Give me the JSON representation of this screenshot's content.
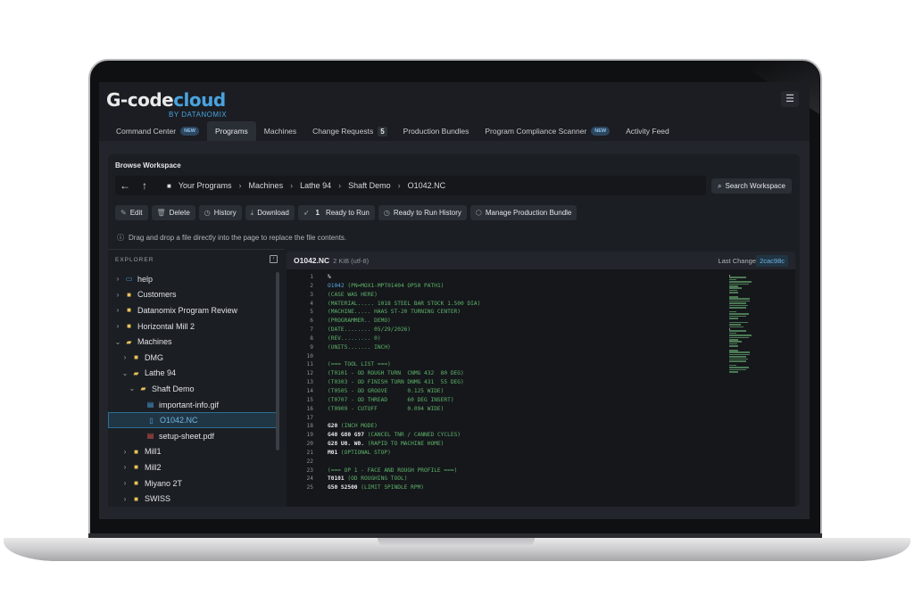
{
  "app": {
    "logo_main": "G-code",
    "logo_accent": "cloud",
    "logo_sub": "BY DATANOMIX",
    "menu_icon": "hamburger-icon"
  },
  "tabs": [
    {
      "label": "Command Center",
      "badge": "NEW"
    },
    {
      "label": "Programs",
      "active": true
    },
    {
      "label": "Machines"
    },
    {
      "label": "Change Requests",
      "count": "5"
    },
    {
      "label": "Production Bundles"
    },
    {
      "label": "Program Compliance Scanner",
      "badge": "NEW"
    },
    {
      "label": "Activity Feed"
    }
  ],
  "workspace": {
    "title": "Browse Workspace",
    "breadcrumb": [
      "Your Programs",
      "Machines",
      "Lathe 94",
      "Shaft Demo",
      "O1042.NC"
    ],
    "search_label": "Search Workspace",
    "hint": "Drag and drop a file directly into the page to replace the file contents."
  },
  "actions": {
    "edit": "Edit",
    "delete": "Delete",
    "history": "History",
    "download": "Download",
    "ready_count": "1",
    "ready": "Ready to Run",
    "ready_history": "Ready to Run History",
    "manage_bundle": "Manage Production Bundle"
  },
  "explorer": {
    "heading": "EXPLORER",
    "nodes": [
      {
        "label": "help",
        "type": "help",
        "depth": 0,
        "chev": "›"
      },
      {
        "label": "Customers",
        "type": "folder",
        "depth": 0,
        "chev": "›"
      },
      {
        "label": "Datanomix Program Review",
        "type": "folder",
        "depth": 0,
        "chev": "›"
      },
      {
        "label": "Horizontal Mill 2",
        "type": "folder",
        "depth": 0,
        "chev": "›"
      },
      {
        "label": "Machines",
        "type": "folder-open",
        "depth": 0,
        "chev": "⌄"
      },
      {
        "label": "DMG",
        "type": "folder",
        "depth": 1,
        "chev": "›"
      },
      {
        "label": "Lathe 94",
        "type": "folder-open",
        "depth": 1,
        "chev": "⌄"
      },
      {
        "label": "Shaft Demo",
        "type": "folder-open",
        "depth": 2,
        "chev": "⌄"
      },
      {
        "label": "important-info.gif",
        "type": "doc",
        "depth": 3,
        "chev": ""
      },
      {
        "label": "O1042.NC",
        "type": "file",
        "depth": 3,
        "chev": "",
        "selected": true
      },
      {
        "label": "setup-sheet.pdf",
        "type": "pdf",
        "depth": 3,
        "chev": ""
      },
      {
        "label": "Mill1",
        "type": "folder",
        "depth": 1,
        "chev": "›"
      },
      {
        "label": "Mill2",
        "type": "folder",
        "depth": 1,
        "chev": "›"
      },
      {
        "label": "Miyano 2T",
        "type": "folder",
        "depth": 1,
        "chev": "›"
      },
      {
        "label": "SWISS",
        "type": "folder",
        "depth": 1,
        "chev": "›"
      }
    ]
  },
  "editor": {
    "filename": "O1042.NC",
    "meta": "2 KiB (utf-8)",
    "last_change_label": "Last Change",
    "last_change_hash": "2cac98c",
    "lines": [
      {
        "n": "1",
        "t": "%",
        "k": "tx"
      },
      {
        "n": "2",
        "t": "O1042",
        "c": " (PN=MOX1-MPT01404 OP50 PATH1)",
        "k": "kw"
      },
      {
        "n": "3",
        "c": "(CASE WAS HERE)"
      },
      {
        "n": "4",
        "c": "(MATERIAL..... 1018 STEEL BAR STOCK 1.500 DIA)"
      },
      {
        "n": "5",
        "c": "(MACHINE..... HAAS ST-20 TURNING CENTER)"
      },
      {
        "n": "6",
        "c": "(PROGRAMMER.. DEMO)"
      },
      {
        "n": "7",
        "c": "(DATE........ 05/29/2026)"
      },
      {
        "n": "8",
        "c": "(REV......... 0)"
      },
      {
        "n": "9",
        "c": "(UNITS....... INCH)"
      },
      {
        "n": "10",
        "t": ""
      },
      {
        "n": "11",
        "c": "(=== TOOL LIST ===)"
      },
      {
        "n": "12",
        "c": "(T0101 - OD ROUGH TURN  CNMG 432  80 DEG)"
      },
      {
        "n": "13",
        "c": "(T0303 - OD FINISH TURN DNMG 431  55 DEG)"
      },
      {
        "n": "14",
        "c": "(T0505 - OD GROOVE      0.125 WIDE)"
      },
      {
        "n": "15",
        "c": "(T0707 - OD THREAD      60 DEG INSERT)"
      },
      {
        "n": "16",
        "c": "(T0909 - CUTOFF         0.094 WIDE)"
      },
      {
        "n": "17",
        "t": ""
      },
      {
        "n": "18",
        "t": "G20",
        "c": " (INCH MODE)"
      },
      {
        "n": "19",
        "t": "G40 G80 G97",
        "c": " (CANCEL TNR / CANNED CYCLES)"
      },
      {
        "n": "20",
        "t": "G28 U0. W0.",
        "c": " (RAPID TO MACHINE HOME)"
      },
      {
        "n": "21",
        "t": "M01",
        "c": " (OPTIONAL STOP)"
      },
      {
        "n": "22",
        "t": ""
      },
      {
        "n": "23",
        "c": "(=== OP 1 - FACE AND ROUGH PROFILE ===)"
      },
      {
        "n": "24",
        "t": "T0101",
        "c": " (OD ROUGHING TOOL)"
      },
      {
        "n": "25",
        "t": "G50 S2500",
        "c": " (LIMIT SPINDLE RPM)"
      }
    ]
  },
  "colors": {
    "accent": "#4aa3df",
    "comment": "#5fb36a",
    "folder": "#e7c35a",
    "pdf": "#e25656",
    "chat": "#5ab8e6"
  },
  "icons": {
    "back": "arrow-left-icon",
    "up": "arrow-up-icon",
    "chat": "chat-icon"
  }
}
